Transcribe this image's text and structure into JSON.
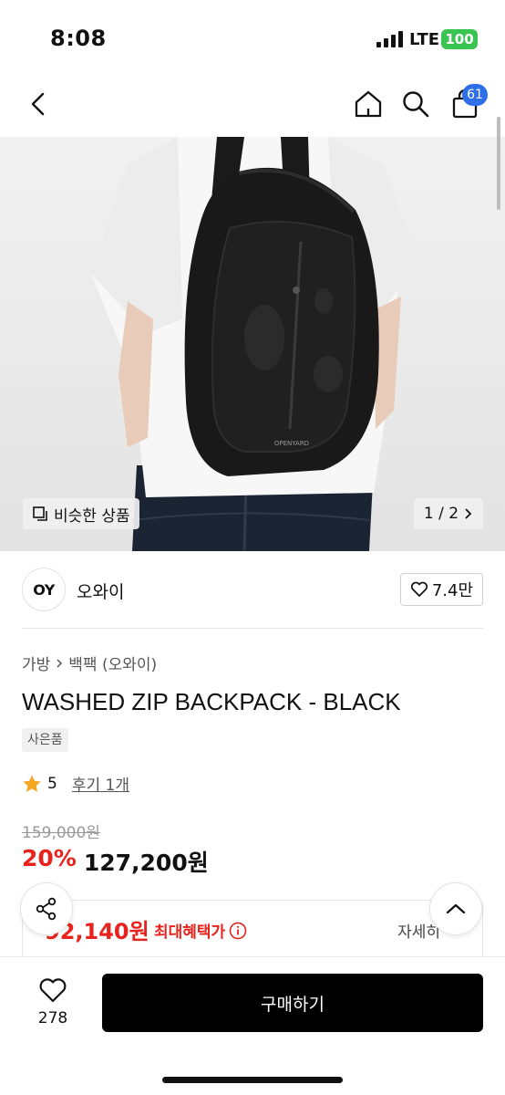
{
  "status": {
    "time": "8:08",
    "network": "LTE",
    "battery": "100"
  },
  "nav": {
    "cart_count": "61"
  },
  "gallery": {
    "similar_label": "비슷한 상품",
    "pager": "1 / 2",
    "bag_brand_text": "OPENYARD"
  },
  "brand": {
    "logo": "OY",
    "name": "오와이",
    "likes": "7.4만"
  },
  "breadcrumb": {
    "category": "가방",
    "subcategory": "백팩 (오와이)"
  },
  "product": {
    "title": "WASHED ZIP BACKPACK - BLACK",
    "badge": "사은품",
    "rating": "5",
    "review_link": "후기 1개",
    "original_price": "159,000원",
    "discount": "20%",
    "price": "127,200원"
  },
  "benefit": {
    "price": "92,140원",
    "label": "최대혜택가",
    "detail": "자세히"
  },
  "bottom": {
    "wish_count": "278",
    "buy_label": "구매하기"
  },
  "colors": {
    "accent_red": "#e8231d",
    "badge_blue": "#2e6ee6",
    "battery_green": "#3ac452",
    "star_gold": "#f5a623"
  },
  "icons": [
    "back-icon",
    "home-icon",
    "search-icon",
    "cart-icon",
    "copy-icon",
    "chevron-right-icon",
    "heart-icon",
    "star-icon",
    "info-icon",
    "share-icon",
    "chevron-up-icon"
  ]
}
